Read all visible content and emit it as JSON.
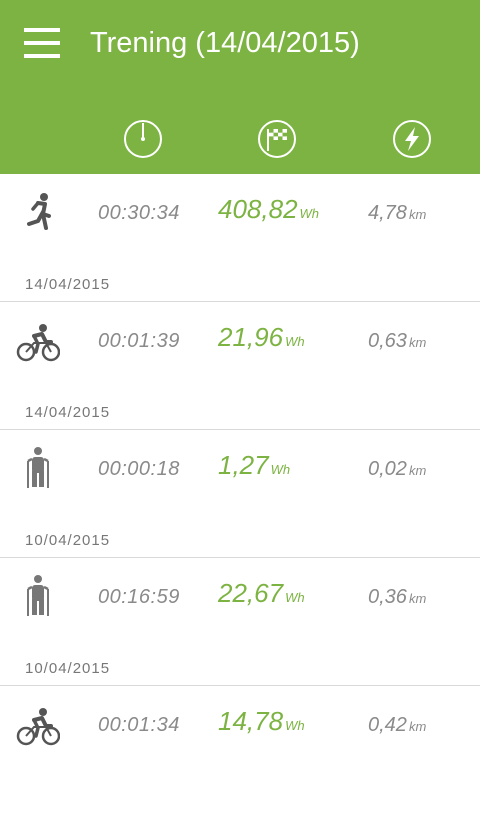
{
  "header": {
    "title": "Trening (14/04/2015)",
    "menu_icon": "hamburger-menu-icon",
    "column_icons": [
      "timer-icon",
      "checkered-flag-icon",
      "lightning-icon"
    ]
  },
  "colors": {
    "primary": "#7cb342",
    "text_muted": "#8a8a8a",
    "divider": "#d9d9d9"
  },
  "sessions": [
    {
      "activity": "running",
      "icon": "running-icon",
      "duration": "00:30:34",
      "energy": "408,82",
      "energy_unit": "Wh",
      "distance": "4,78",
      "distance_unit": "km",
      "date": "14/04/2015"
    },
    {
      "activity": "cycling",
      "icon": "cycling-icon",
      "duration": "00:01:39",
      "energy": "21,96",
      "energy_unit": "Wh",
      "distance": "0,63",
      "distance_unit": "km",
      "date": "14/04/2015"
    },
    {
      "activity": "nordic-walking",
      "icon": "nordic-walking-icon",
      "duration": "00:00:18",
      "energy": "1,27",
      "energy_unit": "Wh",
      "distance": "0,02",
      "distance_unit": "km",
      "date": "10/04/2015"
    },
    {
      "activity": "nordic-walking",
      "icon": "nordic-walking-icon",
      "duration": "00:16:59",
      "energy": "22,67",
      "energy_unit": "Wh",
      "distance": "0,36",
      "distance_unit": "km",
      "date": "10/04/2015"
    },
    {
      "activity": "cycling",
      "icon": "cycling-icon",
      "duration": "00:01:34",
      "energy": "14,78",
      "energy_unit": "Wh",
      "distance": "0,42",
      "distance_unit": "km",
      "date": ""
    }
  ]
}
